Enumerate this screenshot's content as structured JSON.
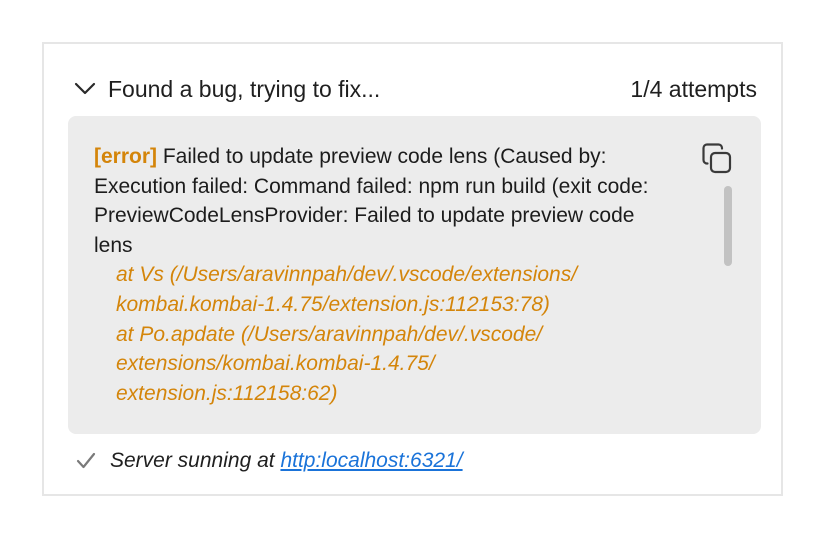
{
  "header": {
    "title": "Found a bug, trying to fix...",
    "attempts": "1/4 attempts"
  },
  "error": {
    "tag": "[error]",
    "message_lines": [
      "Failed to update preview code lens (Caused by:",
      "Execution failed: Command failed: npm run build (exit code:",
      "PreviewCodeLensProvider: Failed to update preview code",
      "lens"
    ],
    "stack_lines": [
      "at Vs (/Users/aravinnpah/dev/.vscode/extensions/",
      "kombai.kombai-1.4.75/extension.js:112153:78)",
      "at Po.apdate (/Users/aravinnpah/dev/.vscode/",
      "extensions/kombai.kombai-1.4.75/",
      "extension.js:112158:62)"
    ],
    "copy_icon": "copy-icon"
  },
  "status": {
    "icon": "check-icon",
    "text": "Server sunning at ",
    "link": "http:localhost:6321/"
  },
  "colors": {
    "accent_error": "#d4850a",
    "link": "#1a73d9",
    "box_bg": "#ececec",
    "border": "#e6e6e6"
  }
}
